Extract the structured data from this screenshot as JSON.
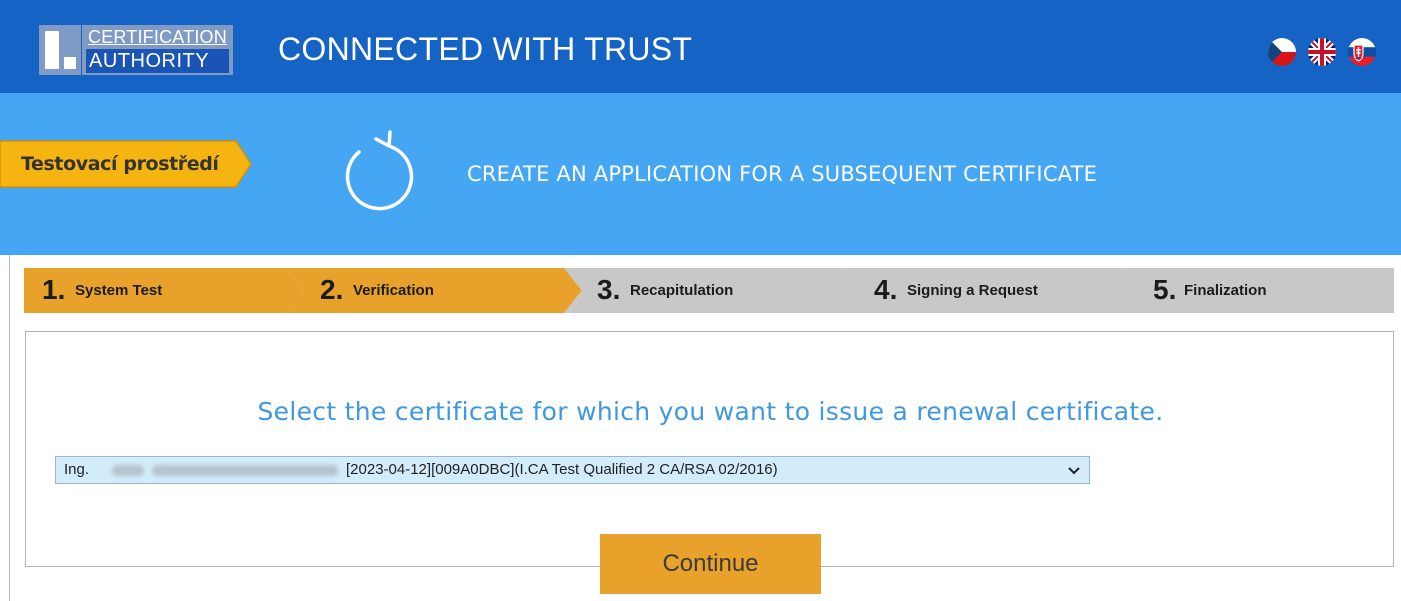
{
  "header": {
    "logo": {
      "line1": "CERTIFICATION",
      "line2": "AUTHORITY"
    },
    "tagline": "CONNECTED WITH TRUST",
    "languages": [
      {
        "code": "cs",
        "icon": "czech-flag-icon"
      },
      {
        "code": "en",
        "icon": "uk-flag-icon"
      },
      {
        "code": "sk",
        "icon": "slovak-flag-icon"
      }
    ]
  },
  "banner": {
    "environment_badge": "Testovací prostředí",
    "icon": "refresh-icon",
    "title": "CREATE AN APPLICATION FOR A SUBSEQUENT CERTIFICATE"
  },
  "steps": [
    {
      "number": "1.",
      "label": "System Test",
      "state": "completed"
    },
    {
      "number": "2.",
      "label": "Verification",
      "state": "active"
    },
    {
      "number": "3.",
      "label": "Recapitulation",
      "state": "pending"
    },
    {
      "number": "4.",
      "label": "Signing a Request",
      "state": "pending"
    },
    {
      "number": "5.",
      "label": "Finalization",
      "state": "pending"
    }
  ],
  "main": {
    "prompt": "Select the certificate for which you want to issue a renewal certificate.",
    "certificate_select": {
      "prefix": "Ing.",
      "selected_value": "[2023-04-12][009A0DBC](I.CA Test Qualified 2 CA/RSA 02/2016)"
    },
    "continue_label": "Continue"
  },
  "colors": {
    "header": "#1563c4",
    "banner": "#45a7f3",
    "accent": "#e8a12a",
    "badge": "#f5b40f",
    "step_inactive": "#c8c8c8",
    "prompt_text": "#3f98e0",
    "select_bg": "#d3ecfc"
  }
}
